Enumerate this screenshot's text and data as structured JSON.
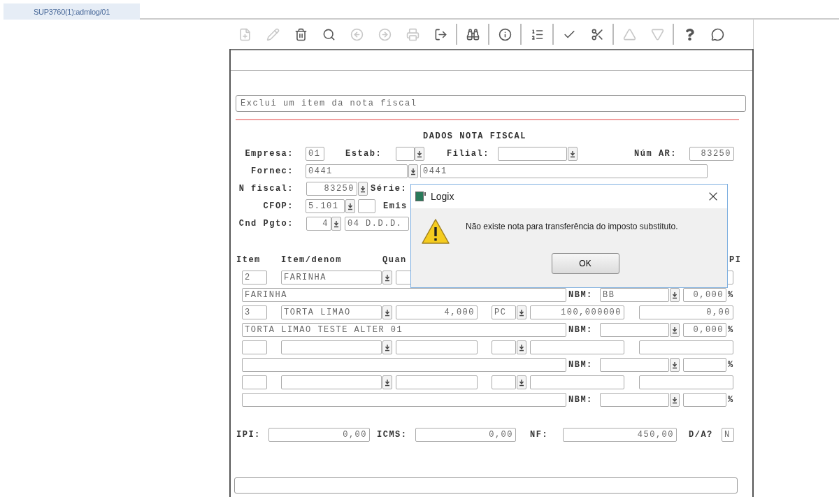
{
  "tab": {
    "label": "SUP3760(1):admlog/01",
    "selected": true
  },
  "toolbar": [
    {
      "kind": "new",
      "disabled": true
    },
    {
      "kind": "edit",
      "disabled": true
    },
    {
      "kind": "delete",
      "disabled": false
    },
    {
      "kind": "find",
      "disabled": false
    },
    {
      "kind": "previous",
      "disabled": true
    },
    {
      "kind": "next",
      "disabled": true
    },
    {
      "kind": "print",
      "disabled": true
    },
    {
      "kind": "exit",
      "disabled": false
    },
    {
      "kind": "separator"
    },
    {
      "kind": "binoculars",
      "disabled": false
    },
    {
      "kind": "separator"
    },
    {
      "kind": "info",
      "disabled": false
    },
    {
      "kind": "separator"
    },
    {
      "kind": "numbered",
      "disabled": false
    },
    {
      "kind": "separator"
    },
    {
      "kind": "confirm",
      "disabled": false
    },
    {
      "kind": "cancel",
      "disabled": false
    },
    {
      "kind": "separator"
    },
    {
      "kind": "up",
      "disabled": true
    },
    {
      "kind": "down",
      "disabled": true
    },
    {
      "kind": "separator"
    },
    {
      "kind": "help",
      "disabled": false
    },
    {
      "kind": "chat",
      "disabled": false
    }
  ],
  "description": "Exclui um item da nota fiscal",
  "section_title": "DADOS NOTA FISCAL",
  "nota": {
    "empresa": {
      "label": "Empresa:",
      "value": "01"
    },
    "estab": {
      "label": "Estab:"
    },
    "filial": {
      "label": "Filial:"
    },
    "num_ar": {
      "label": "Núm AR:",
      "value": "83250"
    },
    "fornec": {
      "label": "Fornec:",
      "code": "0441",
      "name": "0441"
    },
    "n_fiscal": {
      "label": "N fiscal:",
      "value": "83250"
    },
    "serie": {
      "label": "Série:"
    },
    "cfop": {
      "label": "CFOP:",
      "value": "5.101"
    },
    "emissao": {
      "label": "Emis"
    },
    "cnd_pgto": {
      "label": "Cnd Pgto:",
      "code": "4",
      "description": "04 D.D.D."
    }
  },
  "items_header": {
    "item": "Item",
    "item_denom": "Item/denom",
    "quantity": "Quan",
    "column_right": "PI"
  },
  "items": [
    {
      "number": "2",
      "code": "FARINHA",
      "description": "FARINHA",
      "nbm_label": "NBM:",
      "nbm": "BB",
      "percent": "0,000",
      "percent_sign": "%"
    },
    {
      "number": "3",
      "code": "TORTA LIMAO",
      "quantity": "4,000",
      "unit": "PC",
      "price": "100,000000",
      "value": "0,00",
      "description": "TORTA LIMAO TESTE ALTER 01",
      "nbm_label": "NBM:",
      "percent": "0,000",
      "percent_sign": "%"
    },
    {
      "nbm_label": "NBM:",
      "percent_sign": "%"
    },
    {
      "nbm_label": "NBM:",
      "percent_sign": "%"
    }
  ],
  "totals": {
    "ipi": {
      "label": "IPI:",
      "value": "0,00"
    },
    "icms": {
      "label": "ICMS:",
      "value": "0,00"
    },
    "nf": {
      "label": "NF:",
      "value": "450,00"
    },
    "da": {
      "label": "D/A?",
      "value": "N"
    }
  },
  "dialog": {
    "title": "Logix",
    "message": "Não existe nota para transferência do imposto substituto.",
    "button": "OK"
  }
}
